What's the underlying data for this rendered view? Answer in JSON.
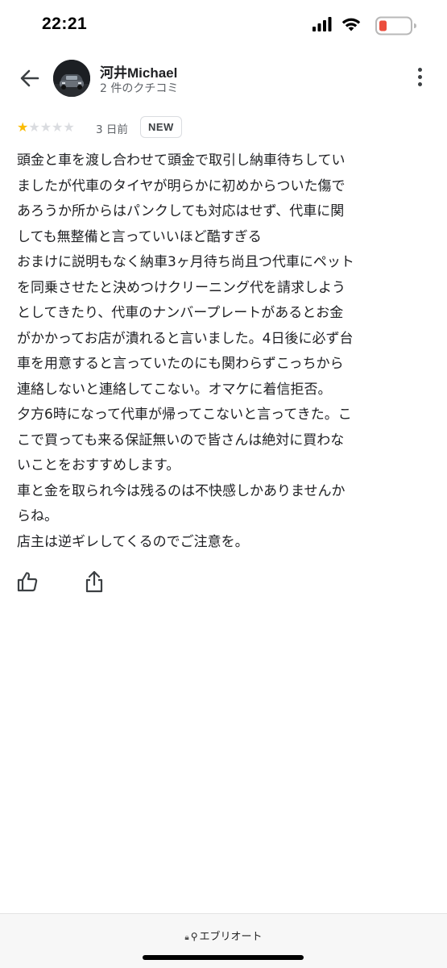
{
  "status_bar": {
    "time": "22:21",
    "battery_color": "#eb4d3d"
  },
  "header": {
    "back_icon": "arrow-left-icon",
    "author_name": "河井Michael",
    "review_count": "2 件のクチコミ",
    "more_icon": "more-vert-icon"
  },
  "rating": {
    "stars": 1,
    "max_stars": 5,
    "star_color": "#fbbc04",
    "date": "3 日前",
    "badge": "NEW"
  },
  "review": {
    "lines": [
      "頭金と車を渡し合わせて頭金で取引し納車待ちしてい",
      "ましたが代車のタイヤが明らかに初めからついた傷で",
      "あろうか所からはパンクしても対応はせず、代車に関",
      "しても無整備と言っていいほど酷すぎる",
      "おまけに説明もなく納車3ヶ月待ち尚且つ代車にペット",
      "を同乗させたと決めつけクリーニング代を請求しよう",
      "としてきたり、代車のナンバープレートがあるとお金",
      "がかかってお店が潰れると言いました。4日後に必ず台",
      "車を用意すると言っていたのにも関わらずこっちから",
      "連絡しないと連絡してこない。オマケに着信拒否。",
      "夕方6時になって代車が帰ってこないと言ってきた。こ",
      "こで買っても来る保証無いので皆さんは絶対に買わな",
      "いことをおすすめします。",
      "車と金を取られ今は残るのは不快感しかありませんか",
      "らね。",
      "店主は逆ギレしてくるのでご注意を。"
    ]
  },
  "actions": {
    "like_icon": "thumbs-up-icon",
    "share_icon": "share-icon"
  },
  "browser": {
    "url_text": "エブリオート",
    "lock_icon": "lock-icon",
    "search_icon": "search-icon"
  }
}
